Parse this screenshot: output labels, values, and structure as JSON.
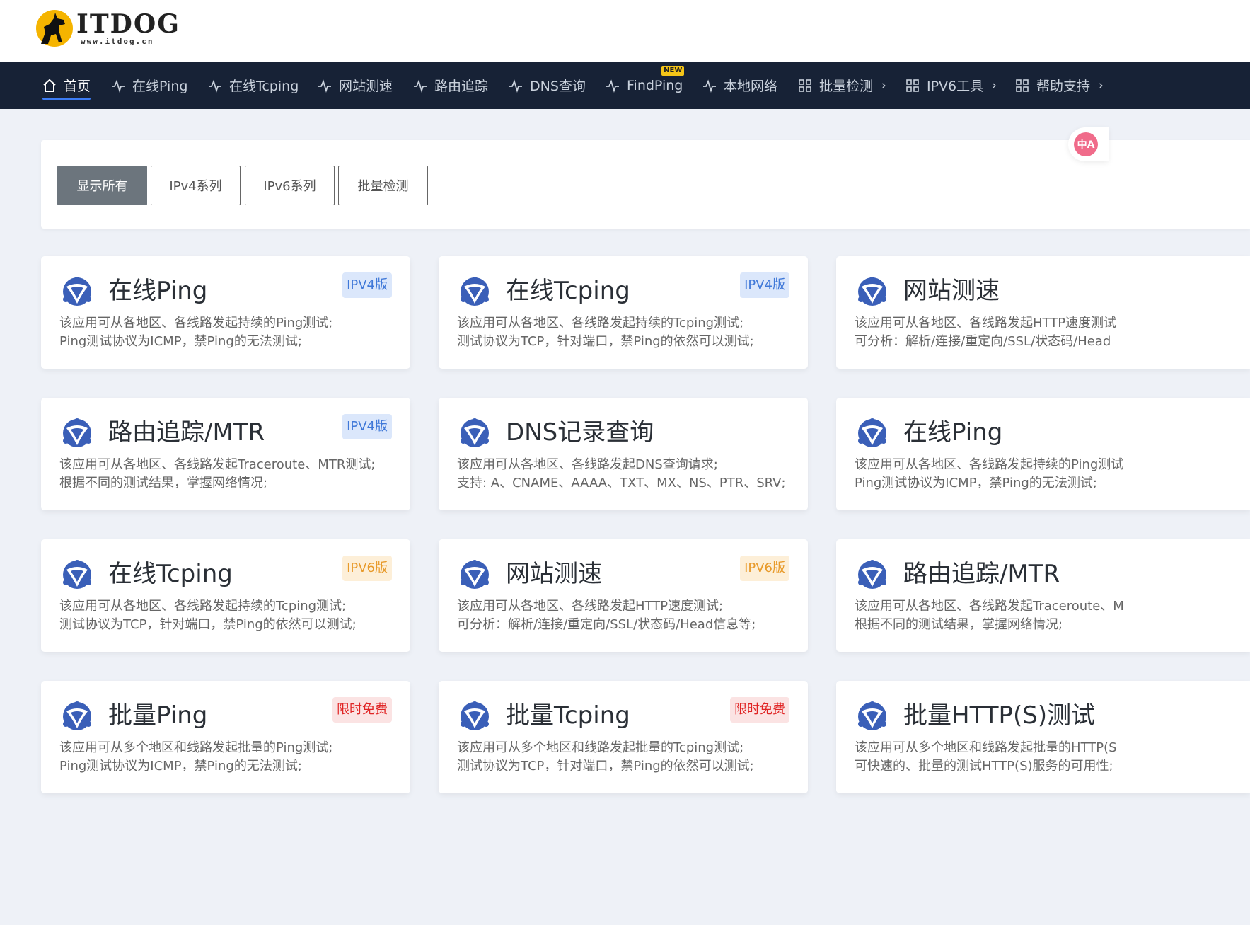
{
  "brand": {
    "title": "ITDOG",
    "url": "www.itdog.cn"
  },
  "nav": {
    "items": [
      {
        "label": "首页",
        "icon": "home-icon",
        "active": true
      },
      {
        "label": "在线Ping",
        "icon": "pulse-icon"
      },
      {
        "label": "在线Tcping",
        "icon": "pulse-icon"
      },
      {
        "label": "网站测速",
        "icon": "pulse-icon"
      },
      {
        "label": "路由追踪",
        "icon": "pulse-icon"
      },
      {
        "label": "DNS查询",
        "icon": "pulse-icon"
      },
      {
        "label": "FindPing",
        "icon": "pulse-icon",
        "badge": "NEW"
      },
      {
        "label": "本地网络",
        "icon": "pulse-icon"
      },
      {
        "label": "批量检测",
        "icon": "grid-icon",
        "chevron": "›"
      },
      {
        "label": "IPV6工具",
        "icon": "grid-icon",
        "chevron": "›"
      },
      {
        "label": "帮助支持",
        "icon": "grid-icon",
        "chevron": "›"
      }
    ]
  },
  "translate": {
    "label": "中A"
  },
  "filters": [
    "显示所有",
    "IPv4系列",
    "IPv6系列",
    "批量检测"
  ],
  "cards": [
    {
      "title": "在线Ping",
      "badge": "IPV4版",
      "badge_type": "v4",
      "line1": "该应用可从各地区、各线路发起持续的Ping测试;",
      "line2": "Ping测试协议为ICMP，禁Ping的无法测试;"
    },
    {
      "title": "在线Tcping",
      "badge": "IPV4版",
      "badge_type": "v4",
      "line1": "该应用可从各地区、各线路发起持续的Tcping测试;",
      "line2": "测试协议为TCP，针对端口，禁Ping的依然可以测试;"
    },
    {
      "title": "网站测速",
      "badge": "",
      "badge_type": "",
      "line1": "该应用可从各地区、各线路发起HTTP速度测试",
      "line2": "可分析：解析/连接/重定向/SSL/状态码/Head"
    },
    {
      "title": "路由追踪/MTR",
      "badge": "IPV4版",
      "badge_type": "v4",
      "line1": "该应用可从各地区、各线路发起Traceroute、MTR测试;",
      "line2": "根据不同的测试结果，掌握网络情况;"
    },
    {
      "title": "DNS记录查询",
      "badge": "",
      "badge_type": "",
      "line1": "该应用可从各地区、各线路发起DNS查询请求;",
      "line2": "支持: A、CNAME、AAAA、TXT、MX、NS、PTR、SRV;"
    },
    {
      "title": "在线Ping",
      "badge": "",
      "badge_type": "",
      "line1": "该应用可从各地区、各线路发起持续的Ping测试",
      "line2": "Ping测试协议为ICMP，禁Ping的无法测试;"
    },
    {
      "title": "在线Tcping",
      "badge": "IPV6版",
      "badge_type": "v6",
      "line1": "该应用可从各地区、各线路发起持续的Tcping测试;",
      "line2": "测试协议为TCP，针对端口，禁Ping的依然可以测试;"
    },
    {
      "title": "网站测速",
      "badge": "IPV6版",
      "badge_type": "v6",
      "line1": "该应用可从各地区、各线路发起HTTP速度测试;",
      "line2": "可分析：解析/连接/重定向/SSL/状态码/Head信息等;"
    },
    {
      "title": "路由追踪/MTR",
      "badge": "",
      "badge_type": "",
      "line1": "该应用可从各地区、各线路发起Traceroute、M",
      "line2": "根据不同的测试结果，掌握网络情况;"
    },
    {
      "title": "批量Ping",
      "badge": "限时免费",
      "badge_type": "free",
      "line1": "该应用可从多个地区和线路发起批量的Ping测试;",
      "line2": "Ping测试协议为ICMP，禁Ping的无法测试;"
    },
    {
      "title": "批量Tcping",
      "badge": "限时免费",
      "badge_type": "free",
      "line1": "该应用可从多个地区和线路发起批量的Tcping测试;",
      "line2": "测试协议为TCP，针对端口，禁Ping的依然可以测试;"
    },
    {
      "title": "批量HTTP(S)测试",
      "badge": "",
      "badge_type": "",
      "line1": "该应用可从多个地区和线路发起批量的HTTP(S",
      "line2": "可快速的、批量的测试HTTP(S)服务的可用性;"
    }
  ]
}
